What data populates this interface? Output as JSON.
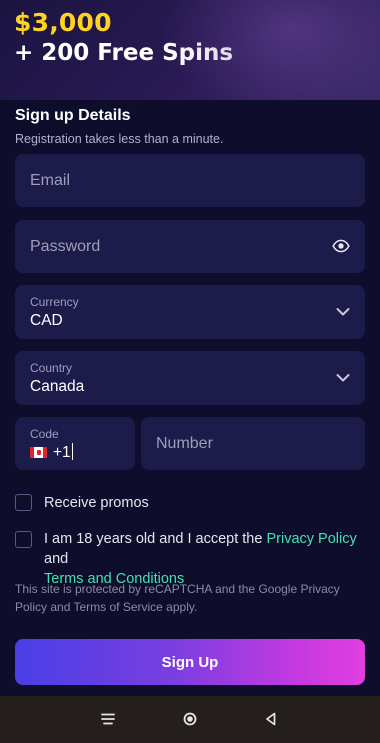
{
  "hero": {
    "amount": "$3,000",
    "bonus": "+ 200 Free Spins"
  },
  "form": {
    "title": "Sign up Details",
    "subtitle": "Registration takes less than a minute.",
    "email_placeholder": "Email",
    "password_placeholder": "Password",
    "currency_label": "Currency",
    "currency_value": "CAD",
    "country_label": "Country",
    "country_value": "Canada",
    "code_label": "Code",
    "code_value": "+1",
    "number_placeholder": "Number",
    "promos_label": "Receive promos",
    "terms_prefix": "I am 18 years old and I accept the ",
    "privacy_link": "Privacy Policy",
    "terms_and": " and",
    "terms_link": "Terms and Conditions",
    "recaptcha_text": "This site is protected by reCAPTCHA and the Google Privacy Policy and Terms of Service apply.",
    "signup_label": "Sign Up"
  },
  "icons": {
    "password_toggle": "eye-icon",
    "currency_dropdown": "chevron-down-icon",
    "country_dropdown": "chevron-down-icon",
    "flag": "canada-flag-icon",
    "nav_recents": "menu-lines-icon",
    "nav_home": "circle-home-icon",
    "nav_back": "triangle-back-icon"
  },
  "colors": {
    "hero_amount": "#ffd322",
    "field_bg": "#1c1b4a",
    "link": "#46e0b0",
    "button_start": "#4a3fe6",
    "button_end": "#e23ee0"
  }
}
